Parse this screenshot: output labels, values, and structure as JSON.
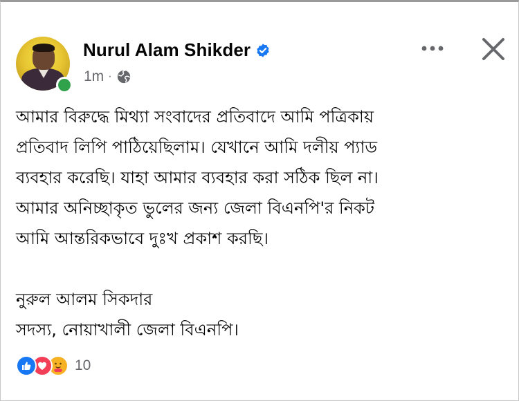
{
  "post": {
    "author_name": "Nurul Alam Shikder",
    "timestamp": "1m",
    "separator": "·",
    "audience_icon": "globe-icon",
    "verified_icon": "verified-badge-icon",
    "body_lines": [
      "আমার বিরুদ্ধে মিথ্যা সংবাদের প্রতিবাদে আমি পত্রিকায়",
      "প্রতিবাদ লিপি পাঠিয়েছিলাম। যেখানে আমি দলীয় প্যাড",
      "ব্যবহার করেছি। যাহা আমার ব্যবহার করা সঠিক ছিল না।",
      "আমার  অনিচ্ছাকৃত ভুলের জন্য জেলা বিএনপি'র নিকট",
      "আমি আন্তরিকভাবে দুঃখ প্রকাশ করছি।"
    ],
    "signature_lines": [
      "নুরুল আলম সিকদার",
      "সদস্য, নোয়াখালী জেলা বিএনপি।"
    ],
    "reactions": {
      "icons": [
        "like-icon",
        "love-icon",
        "care-icon"
      ],
      "count": "10"
    }
  },
  "actions": {
    "more_icon": "more-options-icon",
    "close_icon": "close-icon"
  },
  "colors": {
    "verified_blue": "#1877f2",
    "online_green": "#31a24c",
    "secondary_text": "#65676b",
    "like_blue": "#1877f2",
    "love_red": "#f33e58",
    "care_yellow": "#f7b125"
  }
}
